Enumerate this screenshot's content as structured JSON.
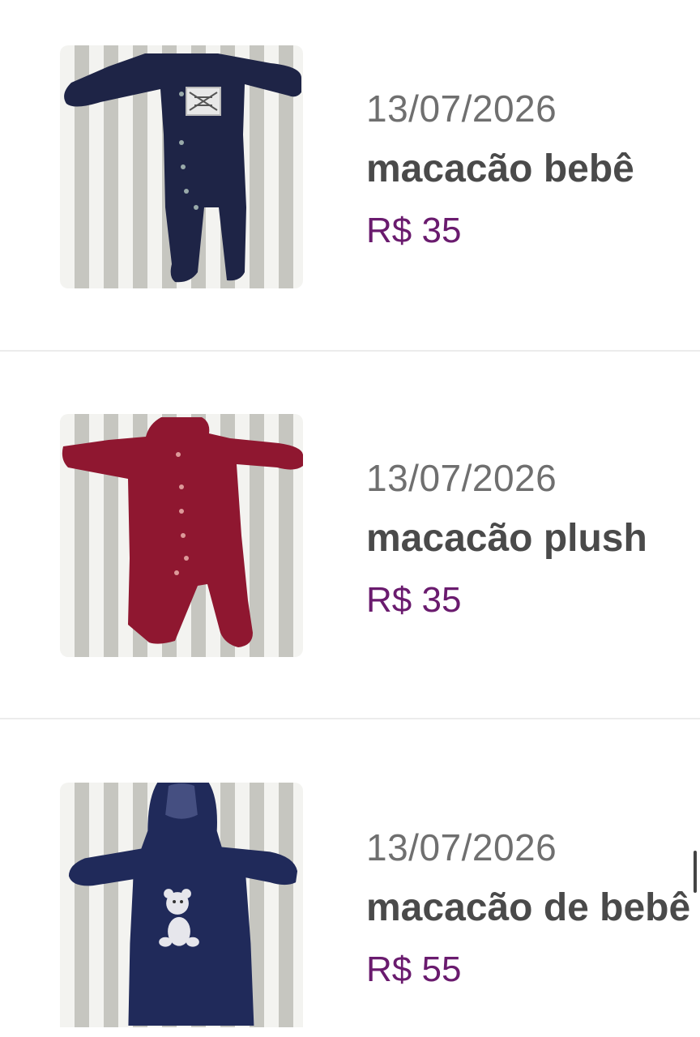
{
  "items": [
    {
      "date": "13/07/2026",
      "title": "macacão bebê",
      "price": "R$ 35",
      "image_icon": "navy-baby-romper-photo",
      "garment_color": "#1e2446"
    },
    {
      "date": "13/07/2026",
      "title": "macacão plush",
      "price": "R$ 35",
      "image_icon": "red-baby-romper-photo",
      "garment_color": "#8f1730"
    },
    {
      "date": "13/07/2026",
      "title": "macacão de bebê",
      "price": "R$ 55",
      "image_icon": "navy-hooded-romper-with-bear-photo",
      "garment_color": "#202a5a"
    }
  ],
  "colors": {
    "price": "#6a1b6e",
    "title": "#4a4a4a",
    "date": "#6f6f6f",
    "divider": "#ececec"
  }
}
